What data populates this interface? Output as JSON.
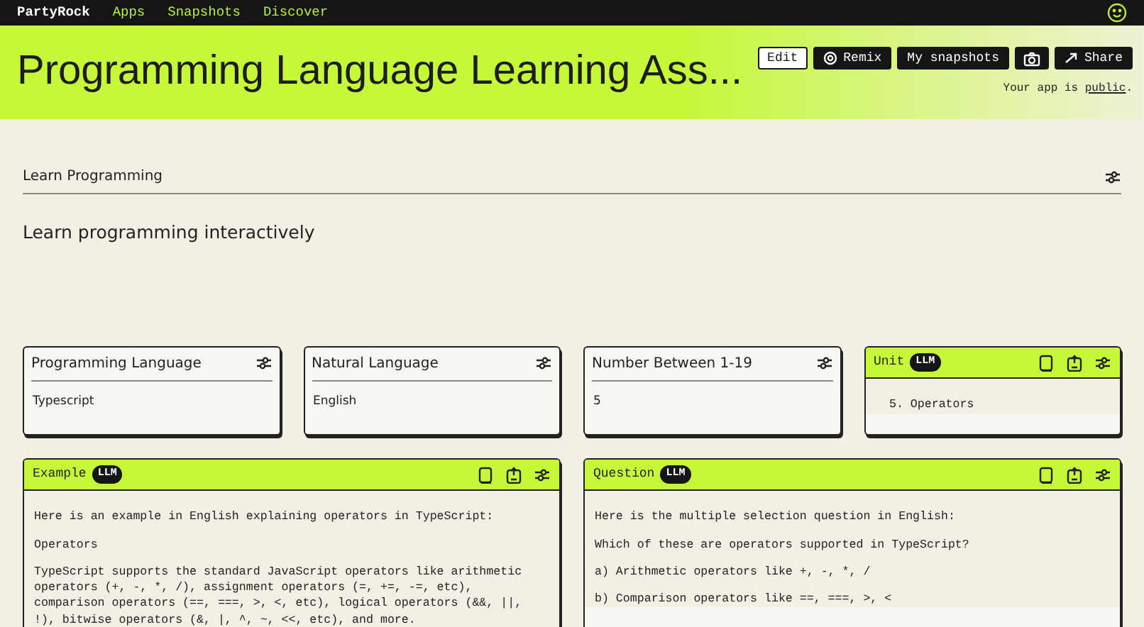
{
  "navbar": {
    "brand": "PartyRock",
    "links": [
      {
        "label": "Apps"
      },
      {
        "label": "Snapshots"
      },
      {
        "label": "Discover"
      }
    ]
  },
  "header": {
    "title": "Programming Language Learning Ass...",
    "buttons": [
      {
        "label": "Edit",
        "kind": "outline"
      },
      {
        "label": "Remix",
        "kind": "remix"
      },
      {
        "label": "My snapshots",
        "kind": "snapshots"
      },
      {
        "label": "Share",
        "kind": "share"
      }
    ],
    "visibility_text": "Your app is ",
    "visibility_link": "public",
    "visibility_end": "."
  },
  "app": {
    "section_title": "Learn Programming",
    "description": "Learn programming interactively"
  },
  "widgets": [
    {
      "title": "Programming Language",
      "llm": false,
      "value": "Typescript"
    },
    {
      "title": "Natural Language",
      "llm": false,
      "value": "English"
    },
    {
      "title": "Number Between 1-19",
      "llm": false,
      "value": "5"
    },
    {
      "title": "Unit",
      "llm": true,
      "badge": "LLM",
      "paragraphs": [
        "  5. Operators"
      ]
    },
    {
      "title": "Example",
      "llm": true,
      "badge": "LLM",
      "paragraphs": [
        "Here is an example in English explaining operators in TypeScript:",
        "Operators",
        "TypeScript supports the standard JavaScript operators like arithmetic operators (+, -, *, /), assignment operators (=, +=, -=, etc), comparison operators (==, ===, >, <, etc), logical operators (&&, ||, !), bitwise operators (&, |, ^, ~, <<, etc), and more."
      ]
    },
    {
      "title": "Question",
      "llm": true,
      "badge": "LLM",
      "paragraphs": [
        "Here is the multiple selection question in English:",
        "Which of these are operators supported in TypeScript?",
        "a) Arithmetic operators like +, -, *, /",
        "b) Comparison operators like ==, ===, >, <"
      ]
    }
  ]
}
